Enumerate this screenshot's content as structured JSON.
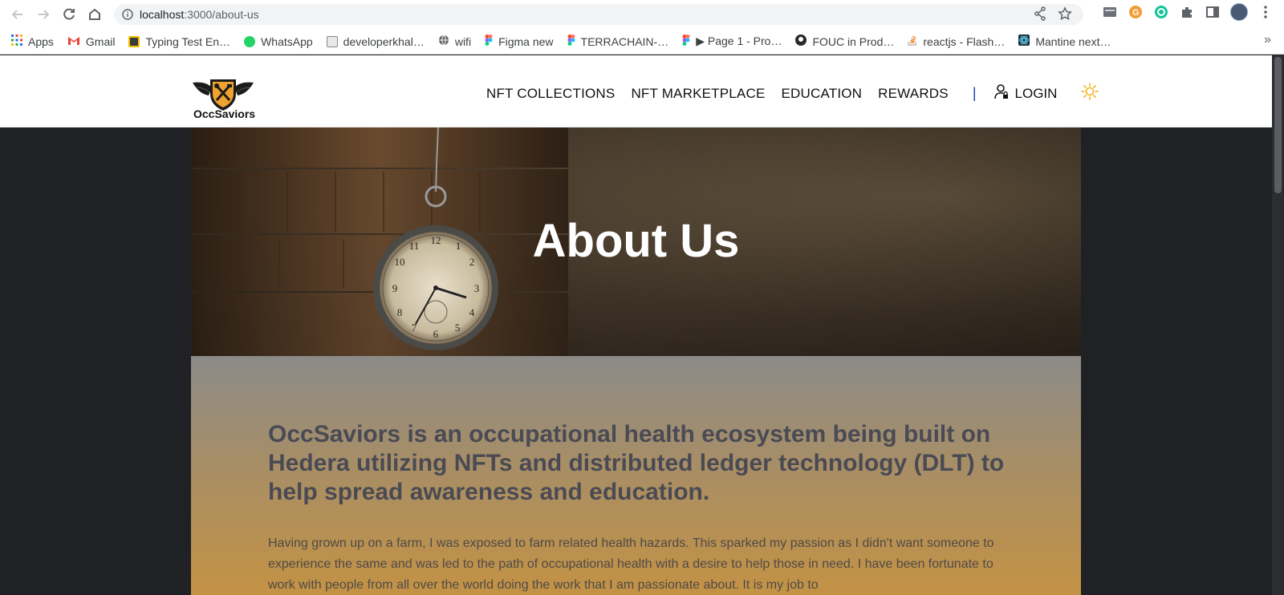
{
  "browser": {
    "url_host": "localhost",
    "url_path": ":3000/about-us",
    "bookmarks": [
      {
        "label": "Apps",
        "color": "#1a73e8"
      },
      {
        "label": "Gmail",
        "color": "#ea4335"
      },
      {
        "label": "Typing Test En…",
        "color": "#3b3b3b"
      },
      {
        "label": "WhatsApp",
        "color": "#25d366"
      },
      {
        "label": "developerkhal…",
        "color": "#666666"
      },
      {
        "label": "wifi",
        "color": "#5f6368"
      },
      {
        "label": "Figma new",
        "color": "#f24e1e"
      },
      {
        "label": "TERRACHAIN-…",
        "color": "#f24e1e"
      },
      {
        "label": "▶ Page 1 - Pro…",
        "color": "#f24e1e"
      },
      {
        "label": "FOUC in Prod…",
        "color": "#24292e"
      },
      {
        "label": "reactjs - Flash…",
        "color": "#f48024"
      },
      {
        "label": "Mantine next…",
        "color": "#228be6"
      }
    ],
    "more": "»"
  },
  "site": {
    "logo_text": "OccSaviors",
    "nav": {
      "items": [
        "NFT COLLECTIONS",
        "NFT MARKETPLACE",
        "EDUCATION",
        "REWARDS"
      ],
      "separator": "|",
      "login": "LOGIN"
    },
    "hero_title": "About Us",
    "lead": "OccSaviors is an occupational health ecosystem being built on Hedera utilizing NFTs and distributed ledger technology (DLT) to help spread awareness and education.",
    "paragraph": "Having grown up on a farm, I was exposed to farm related health hazards. This sparked my passion as I didn't want someone to experience the same and was led to the path of occupational health with a desire to help those in need. I have been fortunate to work with people from all over the world doing the work that I am passionate about. It is my job to"
  },
  "colors": {
    "accent_sun": "#f5b21b",
    "logo_orange": "#f0a22e",
    "nav_separator": "#1d3da8"
  }
}
